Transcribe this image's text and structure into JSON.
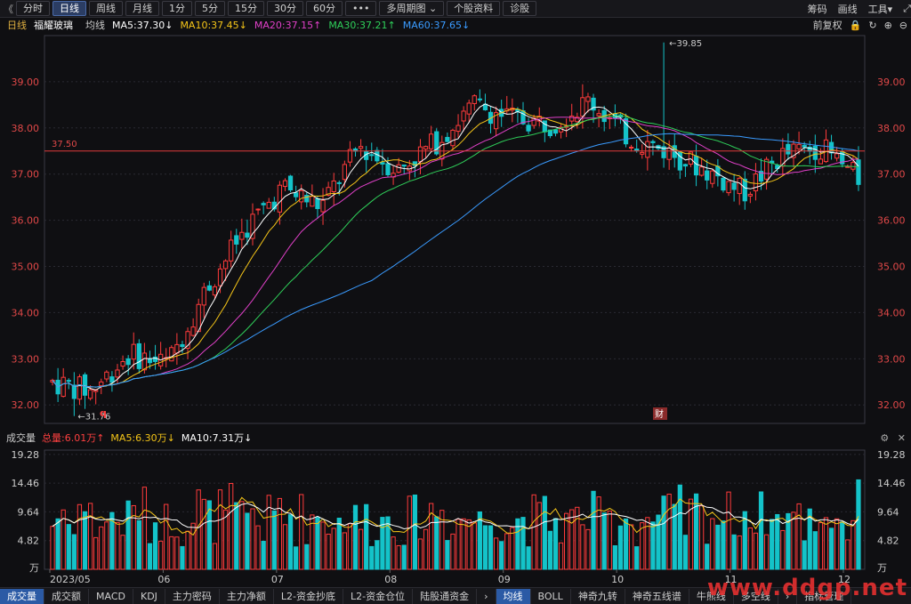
{
  "toolbar": {
    "back": "《",
    "tabs": [
      {
        "label": "分时",
        "active": false
      },
      {
        "label": "日线",
        "active": true
      },
      {
        "label": "周线",
        "active": false
      },
      {
        "label": "月线",
        "active": false
      },
      {
        "label": "1分",
        "active": false
      },
      {
        "label": "5分",
        "active": false
      },
      {
        "label": "15分",
        "active": false
      },
      {
        "label": "30分",
        "active": false
      },
      {
        "label": "60分",
        "active": false
      },
      {
        "label": "•••",
        "active": false
      },
      {
        "label": "多周期图 ⌄",
        "active": false
      },
      {
        "label": "个股资料",
        "active": false
      },
      {
        "label": "诊股",
        "active": false
      }
    ],
    "right": [
      "筹码",
      "画线",
      "工具▾",
      "⤢"
    ]
  },
  "ma_bar": {
    "period": "日线",
    "stock": "福耀玻璃",
    "mode": "均线",
    "items": [
      {
        "label": "MA5:37.30↓",
        "color": "#ffffff"
      },
      {
        "label": "MA10:37.45↓",
        "color": "#f5c518"
      },
      {
        "label": "MA20:37.15↑",
        "color": "#e040c8"
      },
      {
        "label": "MA30:37.21↑",
        "color": "#2fd05a"
      },
      {
        "label": "MA60:37.65↓",
        "color": "#3a9bff"
      }
    ],
    "right": [
      "前复权",
      "🔒",
      "↻",
      "⊕",
      "⊖"
    ]
  },
  "price_axis": {
    "labels": [
      "39.00",
      "38.00",
      "37.00",
      "36.00",
      "35.00",
      "34.00",
      "33.00",
      "32.00"
    ],
    "values": [
      39,
      38,
      37,
      36,
      35,
      34,
      33,
      32
    ]
  },
  "annotations": {
    "high": "39.85",
    "low": "31.76",
    "hline": "37.50",
    "marker_q": "q",
    "marker_cai": "财"
  },
  "vol_bar": {
    "title": "成交量",
    "items": [
      {
        "label": "总量:6.01万↑",
        "color": "#ff4040"
      },
      {
        "label": "MA5:6.30万↓",
        "color": "#f5c518"
      },
      {
        "label": "MA10:7.31万↓",
        "color": "#ffffff"
      }
    ]
  },
  "vol_axis": {
    "labels": [
      "19.28",
      "14.46",
      "9.64",
      "4.82",
      "万"
    ],
    "values": [
      19.28,
      14.46,
      9.64,
      4.82,
      0
    ]
  },
  "date_axis": {
    "labels": [
      "2023/05",
      "06",
      "07",
      "08",
      "09",
      "10",
      "11",
      "12"
    ]
  },
  "bottom_tabs": [
    {
      "label": "成交量",
      "active": true
    },
    {
      "label": "成交额",
      "active": false
    },
    {
      "label": "MACD",
      "active": false
    },
    {
      "label": "KDJ",
      "active": false
    },
    {
      "label": "主力密码",
      "active": false
    },
    {
      "label": "主力净额",
      "active": false
    },
    {
      "label": "L2-资金抄底",
      "active": false
    },
    {
      "label": "L2-资金仓位",
      "active": false
    },
    {
      "label": "陆股通资金",
      "active": false
    },
    {
      "label": "›",
      "active": false
    },
    {
      "label": "均线",
      "active": true
    },
    {
      "label": "BOLL",
      "active": false
    },
    {
      "label": "神奇九转",
      "active": false
    },
    {
      "label": "神奇五线谱",
      "active": false
    },
    {
      "label": "牛熊线",
      "active": false
    },
    {
      "label": "多空线",
      "active": false
    },
    {
      "label": "›",
      "active": false
    },
    {
      "label": "指标管理",
      "active": false
    }
  ],
  "watermark": "www.ddgp.net",
  "colors": {
    "up": "#ff3b3b",
    "down": "#14c3c9",
    "grid": "#2a2a32",
    "axis_text": "#e04848",
    "hline": "#e03a3a"
  },
  "chart_data": {
    "type": "candlestick",
    "title": "福耀玻璃",
    "price_range": [
      31.6,
      40.0
    ],
    "volume_unit": "万",
    "volume_range": [
      0,
      20
    ],
    "anchors": [
      {
        "date": "2023/05",
        "close": 32.5
      },
      {
        "date": "05-mid",
        "close": 32.3
      },
      {
        "date": "06",
        "close": 33.1
      },
      {
        "date": "06-mid",
        "close": 32.9
      },
      {
        "date": "06-late",
        "close": 34.5
      },
      {
        "date": "07",
        "close": 35.8
      },
      {
        "date": "07-mid",
        "close": 36.7
      },
      {
        "date": "07-late",
        "close": 36.3
      },
      {
        "date": "08",
        "close": 37.6
      },
      {
        "date": "08-mid",
        "close": 37.1
      },
      {
        "date": "08-late",
        "close": 37.7
      },
      {
        "date": "09",
        "close": 38.5
      },
      {
        "date": "09-mid",
        "close": 38.2
      },
      {
        "date": "09-late",
        "close": 38.1
      },
      {
        "date": "10",
        "close": 38.6
      },
      {
        "date": "10-mid",
        "close": 37.8
      },
      {
        "date": "10-late",
        "close": 37.5
      },
      {
        "date": "11",
        "close": 37.1
      },
      {
        "date": "11-mid",
        "close": 36.6
      },
      {
        "date": "11-late",
        "close": 37.4
      },
      {
        "date": "12",
        "close": 37.6
      },
      {
        "date": "12-last",
        "close": 36.9
      }
    ]
  }
}
